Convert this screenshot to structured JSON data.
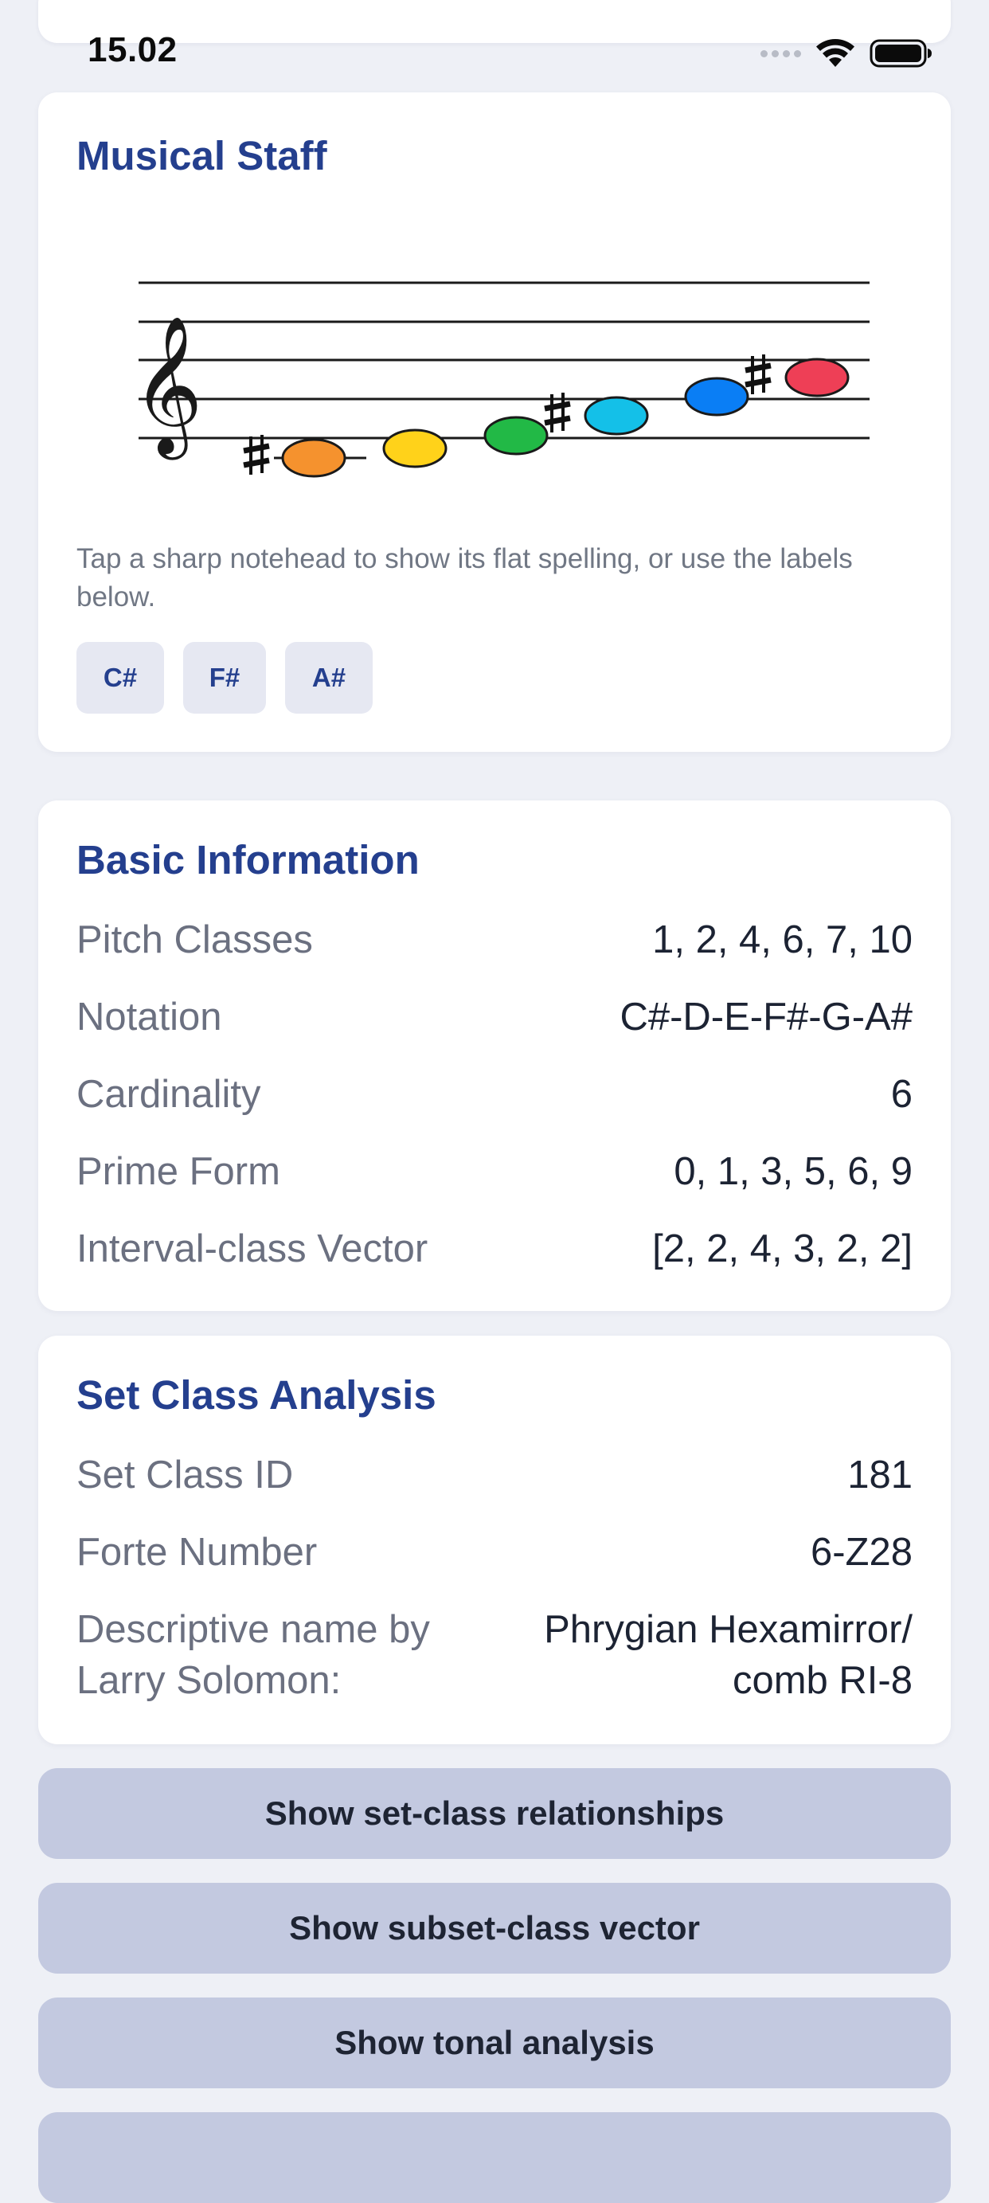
{
  "status_bar": {
    "time": "15.02",
    "icons": [
      "signal-dots-icon",
      "wifi-icon",
      "battery-icon"
    ]
  },
  "staff_card": {
    "title": "Musical Staff",
    "clef": "treble-clef-icon",
    "notes": [
      {
        "pitch": "C#",
        "color": "#f5922e"
      },
      {
        "pitch": "D",
        "color": "#ffd21a"
      },
      {
        "pitch": "E",
        "color": "#22b946"
      },
      {
        "pitch": "F#",
        "color": "#14c0e8"
      },
      {
        "pitch": "G",
        "color": "#0a7ef5"
      },
      {
        "pitch": "A#",
        "color": "#ee3f56"
      }
    ],
    "hint": "Tap a sharp notehead to show its flat spelling, or use the labels below.",
    "chips": [
      "C#",
      "F#",
      "A#"
    ]
  },
  "basic_info": {
    "title": "Basic Information",
    "rows": [
      {
        "label": "Pitch Classes",
        "value": "1, 2, 4, 6, 7, 10"
      },
      {
        "label": "Notation",
        "value": "C#-D-E-F#-G-A#"
      },
      {
        "label": "Cardinality",
        "value": "6"
      },
      {
        "label": "Prime Form",
        "value": "0, 1, 3, 5, 6, 9"
      },
      {
        "label": "Interval-class Vector",
        "value": "[2, 2, 4, 3, 2, 2]"
      }
    ]
  },
  "set_class": {
    "title": "Set Class Analysis",
    "rows": [
      {
        "label": "Set Class ID",
        "value": "181"
      },
      {
        "label": "Forte Number",
        "value": "6-Z28"
      }
    ],
    "descriptive": {
      "label_line1": "Descriptive name by",
      "label_line2": "Larry Solomon:",
      "value_line1": "Phrygian Hexamirror/",
      "value_line2": "comb RI-8"
    }
  },
  "actions": {
    "relationships": "Show set-class relationships",
    "subset_vector": "Show subset-class vector",
    "tonal_analysis": "Show tonal analysis"
  },
  "colors": {
    "accent": "#243f8e",
    "background": "#eef0f6",
    "button": "#c3c9e0",
    "chip": "#e6e8f2"
  }
}
